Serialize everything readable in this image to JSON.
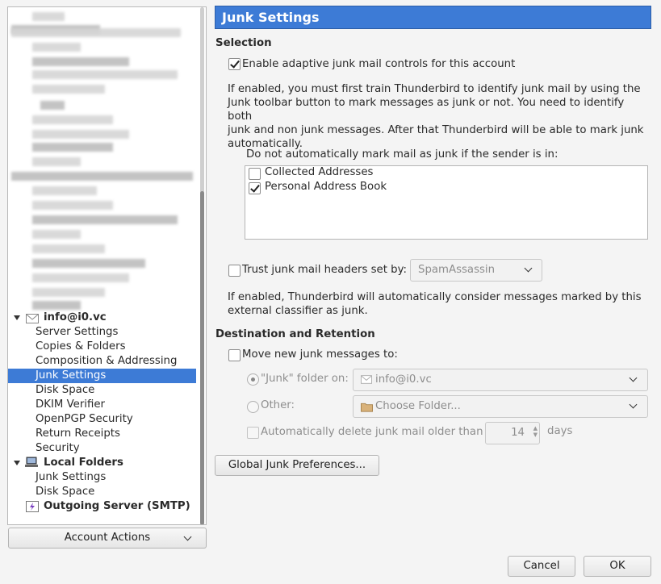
{
  "tree": {
    "account": "info@i0.vc",
    "account_items": [
      "Server Settings",
      "Copies & Folders",
      "Composition & Addressing",
      "Junk Settings",
      "Disk Space",
      "DKIM Verifier",
      "OpenPGP Security",
      "Return Receipts",
      "Security"
    ],
    "selected_item": "Junk Settings",
    "local_folders": "Local Folders",
    "local_items": [
      "Junk Settings",
      "Disk Space"
    ],
    "outgoing": "Outgoing Server (SMTP)"
  },
  "account_actions": "Account Actions",
  "page": {
    "title": "Junk Settings",
    "selection_heading": "Selection",
    "enable_adaptive": {
      "label": "Enable adaptive junk mail controls for this account",
      "checked": true
    },
    "enable_help_lines": [
      "If enabled, you must first train Thunderbird to identify junk mail by using the",
      "Junk toolbar button to mark messages as junk or not. You need to identify both",
      "junk and non junk messages. After that Thunderbird will be able to mark junk",
      "automatically."
    ],
    "whitelist_label": "Do not automatically mark mail as junk if the sender is in:",
    "address_books": [
      {
        "name": "Collected Addresses",
        "checked": false
      },
      {
        "name": "Personal Address Book",
        "checked": true
      }
    ],
    "trust_headers": {
      "label": "Trust junk mail headers set by:",
      "checked": false,
      "value": "SpamAssassin"
    },
    "trust_help_lines": [
      "If enabled, Thunderbird will automatically consider messages marked by this",
      "external classifier as junk."
    ],
    "destination_heading": "Destination and Retention",
    "move_junk": {
      "label": "Move new junk messages to:",
      "checked": false
    },
    "junk_folder_on": {
      "label": "\"Junk\" folder on:",
      "value": "info@i0.vc"
    },
    "other": {
      "label": "Other:",
      "value": "Choose Folder..."
    },
    "auto_delete": {
      "label": "Automatically delete junk mail older than",
      "days": "14",
      "unit": "days"
    },
    "global_prefs_button": "Global Junk Preferences..."
  },
  "footer": {
    "cancel": "Cancel",
    "ok": "OK"
  },
  "colors": {
    "accent": "#3d7bd6",
    "header_border": "#2c5ea8"
  }
}
